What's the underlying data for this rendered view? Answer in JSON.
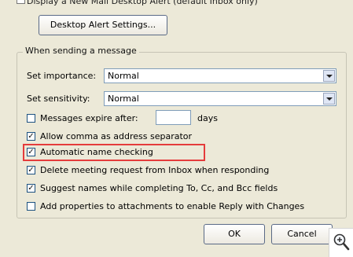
{
  "top_partial": {
    "text": "Display a New Mail Desktop Alert (default Inbox only)"
  },
  "desktop_alert_button": "Desktop Alert Settings...",
  "group": {
    "legend": "When sending a message",
    "importance_label": "Set importance:",
    "importance_value": "Normal",
    "sensitivity_label": "Set sensitivity:",
    "sensitivity_value": "Normal",
    "options": [
      {
        "label": "Messages expire after:",
        "checked": false,
        "suffix": "days"
      },
      {
        "label": "Allow comma as address separator",
        "checked": true
      },
      {
        "label": "Automatic name checking",
        "checked": true
      },
      {
        "label": "Delete meeting request from Inbox when responding",
        "checked": true
      },
      {
        "label": "Suggest names while completing To, Cc, and Bcc fields",
        "checked": true
      },
      {
        "label": "Add properties to attachments to enable Reply with Changes",
        "checked": false
      }
    ]
  },
  "buttons": {
    "ok": "OK",
    "cancel": "Cancel"
  },
  "icons": {
    "zoom": "zoom-in-icon",
    "check": "check-mark"
  },
  "colors": {
    "highlight": "#e53c3c",
    "dialog_bg": "#ece9d8",
    "field_border": "#7f9db9"
  }
}
